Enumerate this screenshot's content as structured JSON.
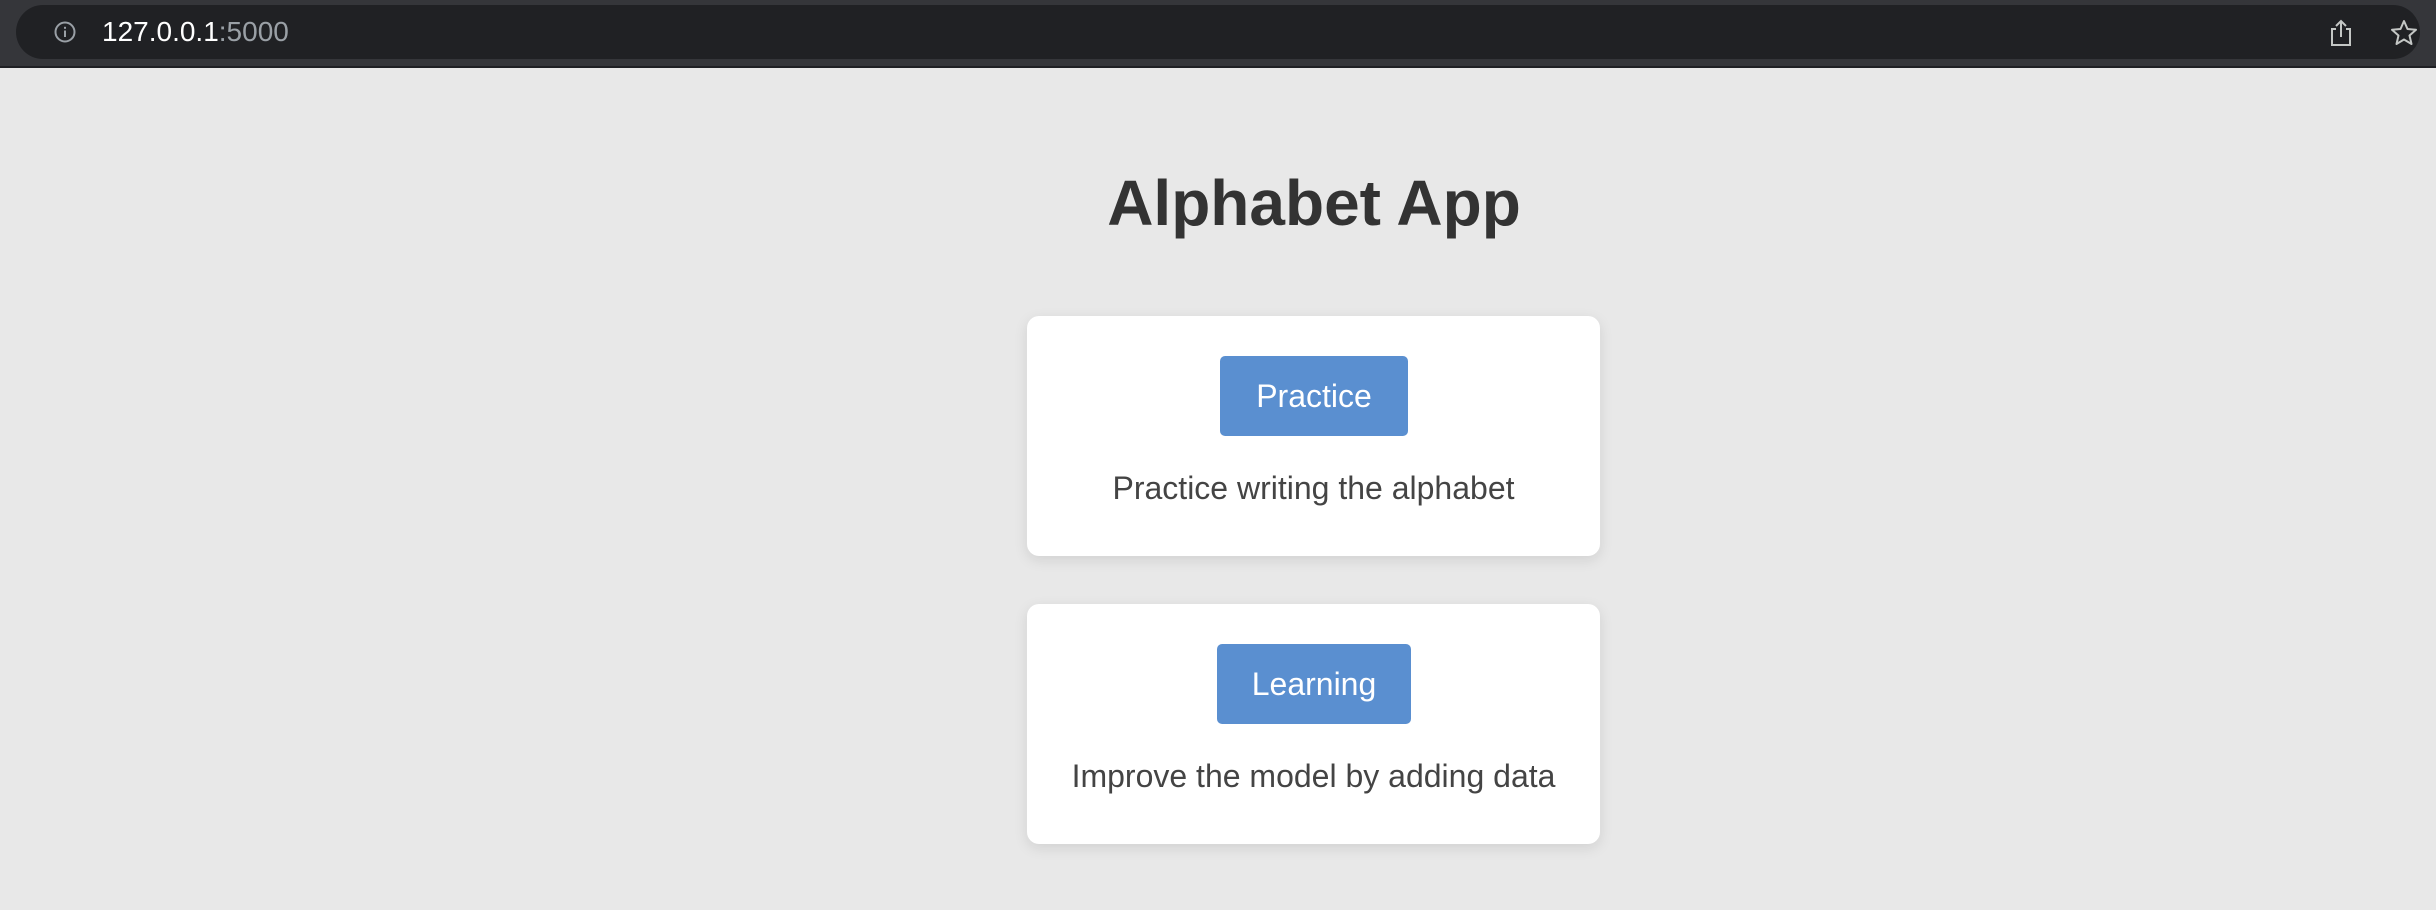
{
  "browser": {
    "url_host": "127.0.0.1",
    "url_port": ":5000",
    "icons": [
      "info-icon",
      "share-icon",
      "star-icon"
    ]
  },
  "page": {
    "title": "Alphabet App"
  },
  "cards": [
    {
      "button_label": "Practice",
      "description": "Practice writing the alphabet"
    },
    {
      "button_label": "Learning",
      "description": "Improve the model by adding data"
    }
  ],
  "colors": {
    "page_background": "#e8e8e8",
    "button_accent": "#5a8fd0",
    "text": "#333333",
    "browser_bar": "#35363a"
  }
}
